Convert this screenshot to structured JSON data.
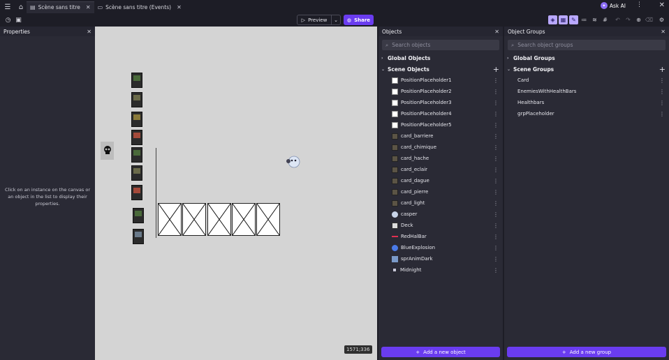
{
  "tabs": [
    {
      "label": "Scène sans titre",
      "active": true
    },
    {
      "label": "Scène sans titre (Events)",
      "active": false
    }
  ],
  "header": {
    "ask_ai": "Ask AI"
  },
  "toolbar": {
    "preview_label": "Preview",
    "share_label": "Share"
  },
  "properties": {
    "title": "Properties",
    "hint": "Click on an instance on the canvas or an object in the list to display their properties."
  },
  "canvas": {
    "coords": "1571;336"
  },
  "objects": {
    "title": "Objects",
    "search_placeholder": "Search objects",
    "global_section": "Global Objects",
    "scene_section": "Scene Objects",
    "items": [
      {
        "label": "PositionPlaceholder1",
        "icon": "placeholder"
      },
      {
        "label": "PositionPlaceholder2",
        "icon": "placeholder"
      },
      {
        "label": "PositionPlaceholder3",
        "icon": "placeholder"
      },
      {
        "label": "PositionPlaceholder4",
        "icon": "placeholder"
      },
      {
        "label": "PositionPlaceholder5",
        "icon": "placeholder"
      },
      {
        "label": "card_barriere",
        "icon": "card"
      },
      {
        "label": "card_chimique",
        "icon": "card"
      },
      {
        "label": "card_hache",
        "icon": "card"
      },
      {
        "label": "card_eclair",
        "icon": "card"
      },
      {
        "label": "card_dague",
        "icon": "card"
      },
      {
        "label": "card_pierre",
        "icon": "card"
      },
      {
        "label": "card_light",
        "icon": "card"
      },
      {
        "label": "casper",
        "icon": "ghost"
      },
      {
        "label": "Deck",
        "icon": "deck"
      },
      {
        "label": "RedHalBar",
        "icon": "bar"
      },
      {
        "label": "BlueExplosion",
        "icon": "explosion"
      },
      {
        "label": "sprAnimDark",
        "icon": "anim"
      },
      {
        "label": "Midnight",
        "icon": "dot"
      }
    ],
    "add_button": "Add a new object"
  },
  "groups": {
    "title": "Object Groups",
    "search_placeholder": "Search object groups",
    "global_section": "Global Groups",
    "scene_section": "Scene Groups",
    "items": [
      {
        "label": "Card"
      },
      {
        "label": "EnemiesWithHealthBars"
      },
      {
        "label": "Healthbars"
      },
      {
        "label": "grpPlaceholder"
      }
    ],
    "add_button": "Add a new group"
  }
}
